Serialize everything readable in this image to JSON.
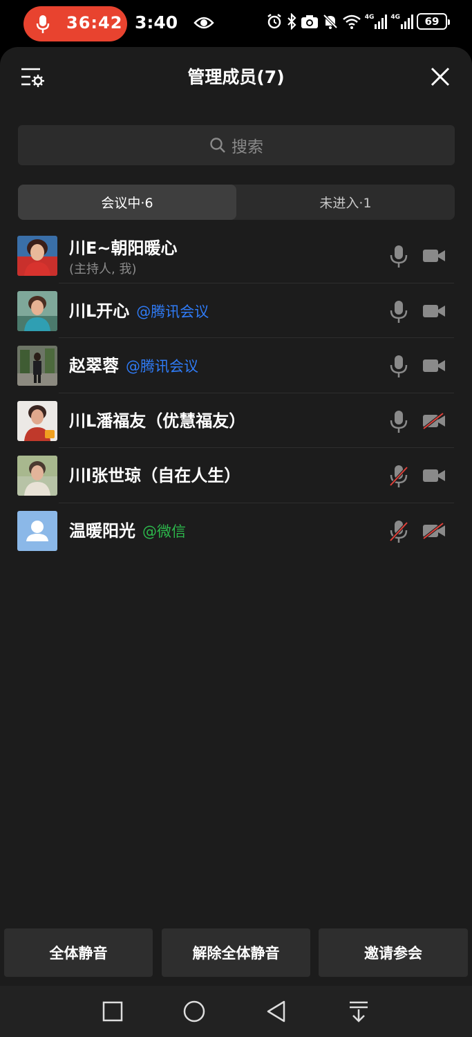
{
  "status_bar": {
    "call_timer": "36:42",
    "time": "3:40",
    "network_1": "4G",
    "network_2": "4G",
    "battery": "69"
  },
  "header": {
    "title": "管理成员(7)"
  },
  "search": {
    "placeholder": "搜索"
  },
  "tabs": [
    {
      "label": "会议中·6",
      "active": true
    },
    {
      "label": "未进入·1",
      "active": false
    }
  ],
  "members": [
    {
      "name": "川E~朝阳暖心",
      "tag": "",
      "subtitle": "(主持人, 我)",
      "mic": "on",
      "camera": "on",
      "avatar": "photo-red"
    },
    {
      "name": "川L开心",
      "tag": "@腾讯会议",
      "tag_color": "#2f7bf6",
      "mic": "on",
      "camera": "on",
      "avatar": "photo-teal"
    },
    {
      "name": "赵翠蓉",
      "tag": "@腾讯会议",
      "tag_color": "#2f7bf6",
      "mic": "on",
      "camera": "on",
      "avatar": "photo-street"
    },
    {
      "name": "川L潘福友（优慧福友）",
      "tag": "",
      "mic": "on",
      "camera": "off",
      "avatar": "photo-portrait"
    },
    {
      "name": "川l张世琼（自在人生）",
      "tag": "",
      "mic": "off",
      "camera": "on",
      "avatar": "photo-outdoor"
    },
    {
      "name": "温暖阳光",
      "tag": "@微信",
      "tag_color": "#2db84c",
      "mic": "off",
      "camera": "off",
      "avatar": "default-user-icon"
    }
  ],
  "actions": {
    "mute_all": "全体静音",
    "unmute_all": "解除全体静音",
    "invite": "邀请参会"
  },
  "colors": {
    "recording": "#e8432f",
    "muted": "#e0413a",
    "sheet_bg": "#1c1c1c"
  }
}
